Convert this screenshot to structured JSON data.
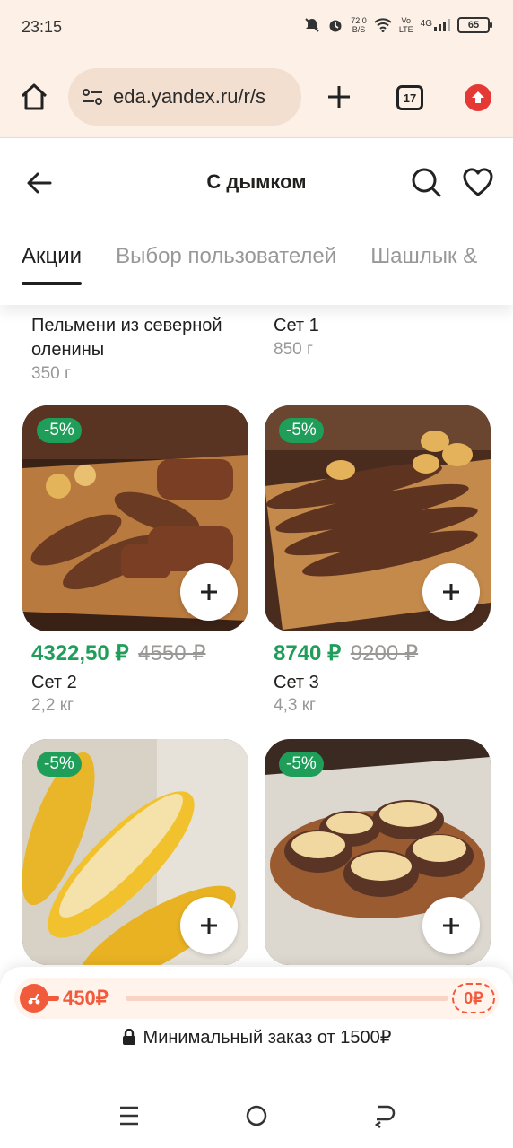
{
  "status": {
    "time": "23:15",
    "net_speed_value": "72,0",
    "net_speed_unit": "B/S",
    "volte_top": "Vo",
    "volte_bottom": "LTE",
    "signal_label": "4G",
    "battery": "65"
  },
  "browser": {
    "url": "eda.yandex.ru/r/s",
    "tab_count": "17"
  },
  "header": {
    "title": "С дымком"
  },
  "categories": [
    {
      "label": "Акции",
      "active": true
    },
    {
      "label": "Выбор пользователей",
      "active": false
    },
    {
      "label": "Шашлык &",
      "active": false
    }
  ],
  "products_top": [
    {
      "name": "Пельмени из северной оленины",
      "weight": "350 г"
    },
    {
      "name": "Сет 1",
      "weight": "850 г"
    }
  ],
  "products": [
    {
      "badge": "-5%",
      "price_new": "4322,50 ₽",
      "price_old": "4550 ₽",
      "name": "Сет 2",
      "weight": "2,2 кг"
    },
    {
      "badge": "-5%",
      "price_new": "8740 ₽",
      "price_old": "9200 ₽",
      "name": "Сет 3",
      "weight": "4,3 кг"
    },
    {
      "badge": "-5%"
    },
    {
      "badge": "-5%"
    }
  ],
  "cart": {
    "amount": "450₽",
    "progress_end": "0₽",
    "progress_fraction": 0.0,
    "min_order": "Минимальный заказ от 1500₽"
  },
  "colors": {
    "accent_green": "#1f9e5a",
    "cart_orange": "#f15a3a",
    "browser_bg": "#fdf0e7"
  }
}
